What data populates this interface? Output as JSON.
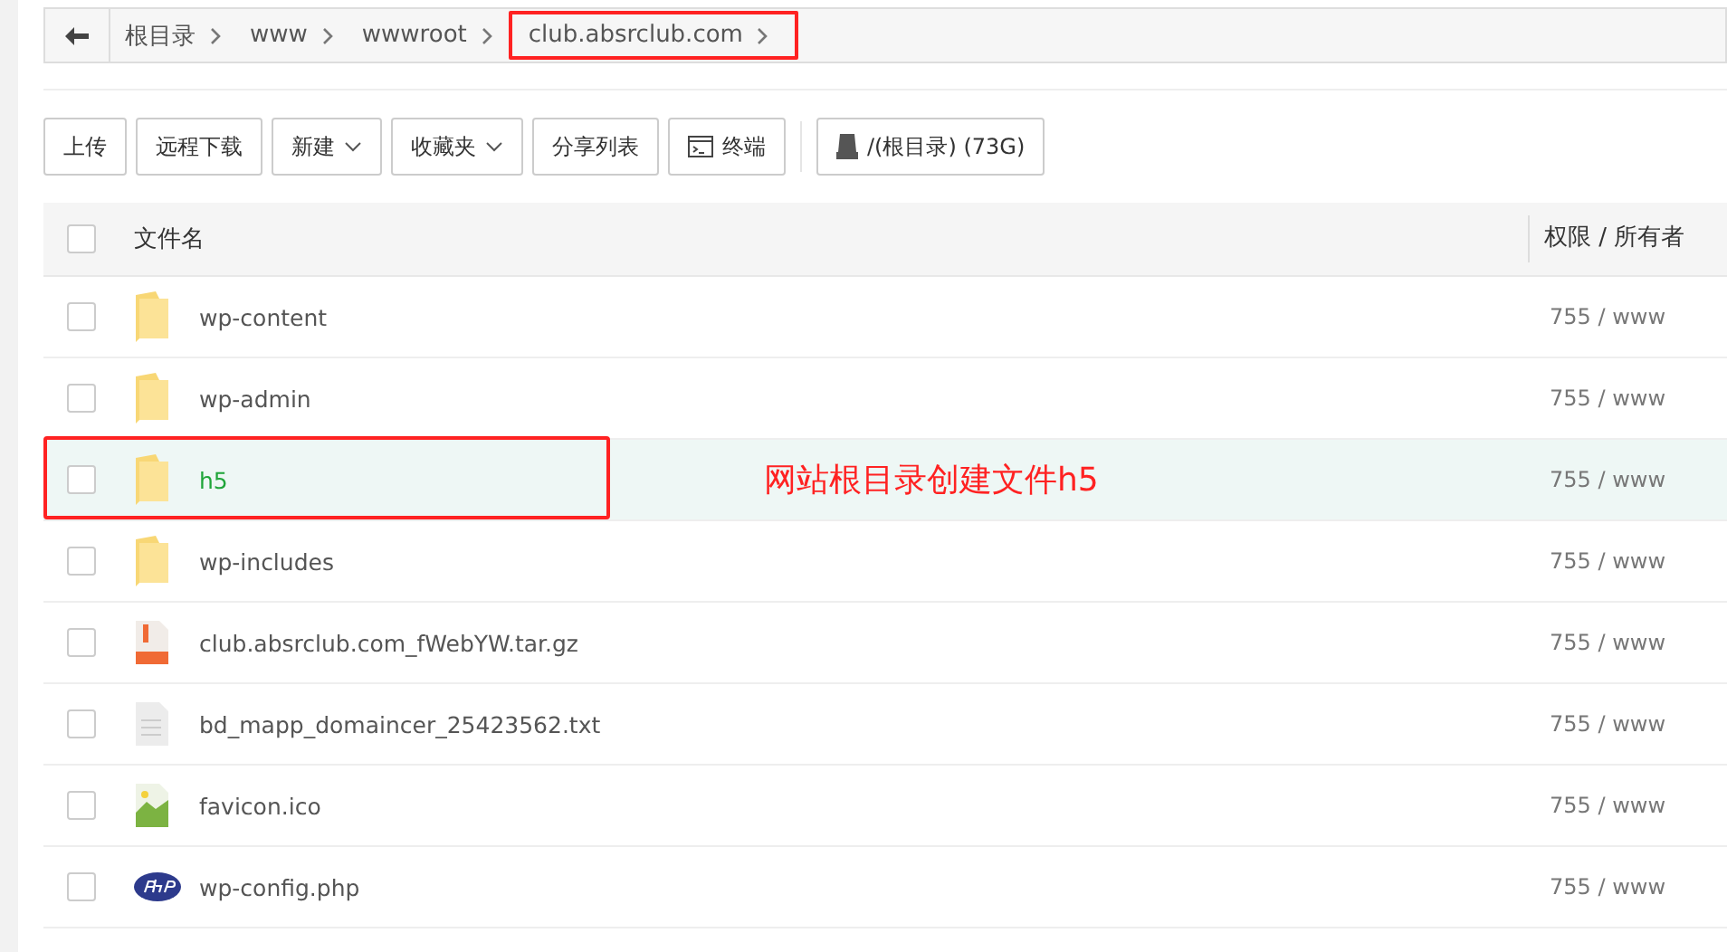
{
  "breadcrumb": {
    "items": [
      {
        "label": "根目录",
        "highlighted": false
      },
      {
        "label": "www",
        "highlighted": false
      },
      {
        "label": "wwwroot",
        "highlighted": false
      },
      {
        "label": "club.absrclub.com",
        "highlighted": true
      }
    ]
  },
  "toolbar": [
    {
      "label": "上传",
      "kind": "plain"
    },
    {
      "label": "远程下载",
      "kind": "plain"
    },
    {
      "label": "新建",
      "kind": "dropdown"
    },
    {
      "label": "收藏夹",
      "kind": "dropdown"
    },
    {
      "label": "分享列表",
      "kind": "plain"
    },
    {
      "label": "终端",
      "kind": "terminal"
    },
    {
      "label": "/(根目录) (73G)",
      "kind": "disk"
    }
  ],
  "table": {
    "columns": [
      "文件名",
      "权限 / 所有者"
    ],
    "header_checked": false,
    "rows": [
      {
        "name": "wp-content",
        "kind": "folder",
        "permission": "755 / www",
        "checked": false,
        "highlighted": false
      },
      {
        "name": "wp-admin",
        "kind": "folder",
        "permission": "755 / www",
        "checked": false,
        "highlighted": false
      },
      {
        "name": "h5",
        "kind": "folder",
        "permission": "755 / www",
        "checked": false,
        "highlighted": true,
        "annotation": "网站根目录创建文件h5"
      },
      {
        "name": "wp-includes",
        "kind": "folder",
        "permission": "755 / www",
        "checked": false,
        "highlighted": false
      },
      {
        "name": "club.absrclub.com_fWebYW.tar.gz",
        "kind": "archive",
        "permission": "755 / www",
        "checked": false,
        "highlighted": false
      },
      {
        "name": "bd_mapp_domaincer_25423562.txt",
        "kind": "text",
        "permission": "755 / www",
        "checked": false,
        "highlighted": false
      },
      {
        "name": "favicon.ico",
        "kind": "image",
        "permission": "755 / www",
        "checked": false,
        "highlighted": false
      },
      {
        "name": "wp-config.php",
        "kind": "php",
        "permission": "755 / www",
        "checked": false,
        "highlighted": false
      }
    ]
  }
}
